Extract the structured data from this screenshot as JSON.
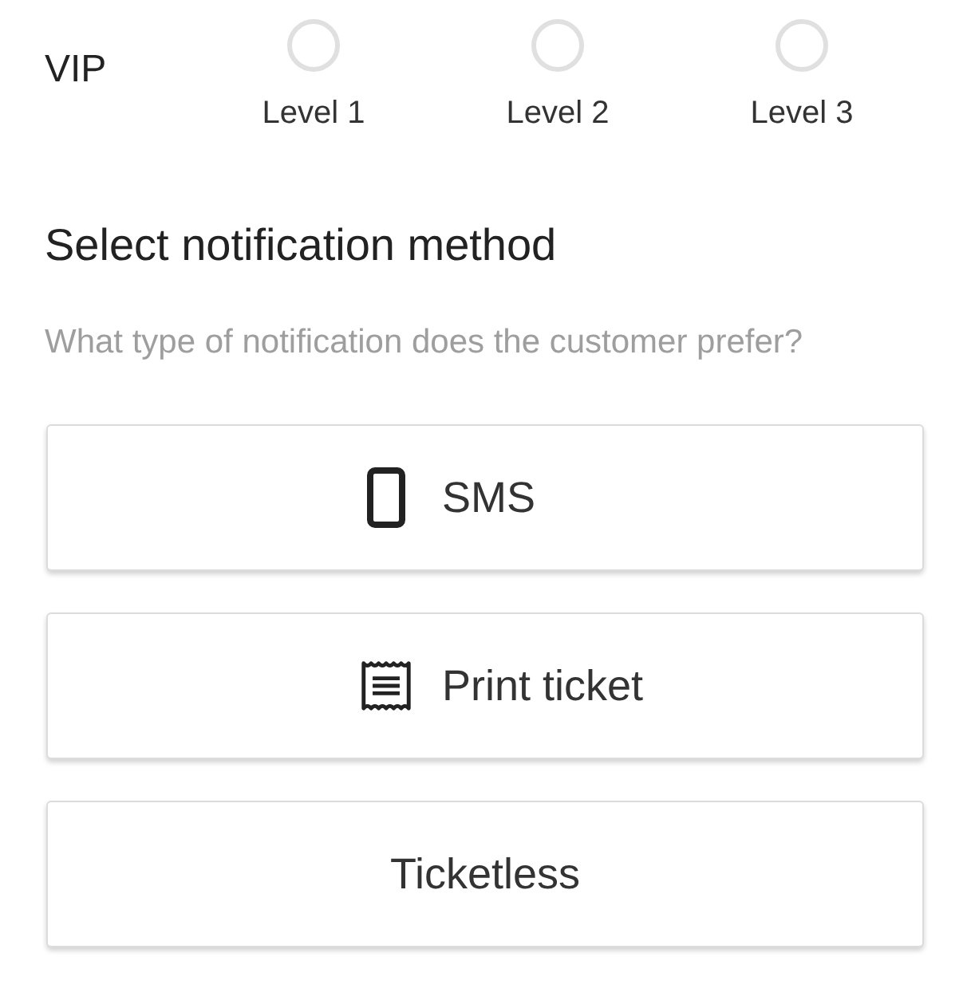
{
  "vip": {
    "label": "VIP",
    "levels": [
      {
        "label": "Level 1",
        "selected": false
      },
      {
        "label": "Level 2",
        "selected": false
      },
      {
        "label": "Level 3",
        "selected": false
      }
    ]
  },
  "notification": {
    "title": "Select notification method",
    "subtitle": "What type of notification does the customer prefer?",
    "options": [
      {
        "kind": "phone",
        "label": "SMS",
        "selected": false
      },
      {
        "kind": "receipt",
        "label": "Print ticket",
        "selected": false
      },
      {
        "kind": "plain",
        "label": "Ticketless",
        "selected": false
      }
    ]
  }
}
